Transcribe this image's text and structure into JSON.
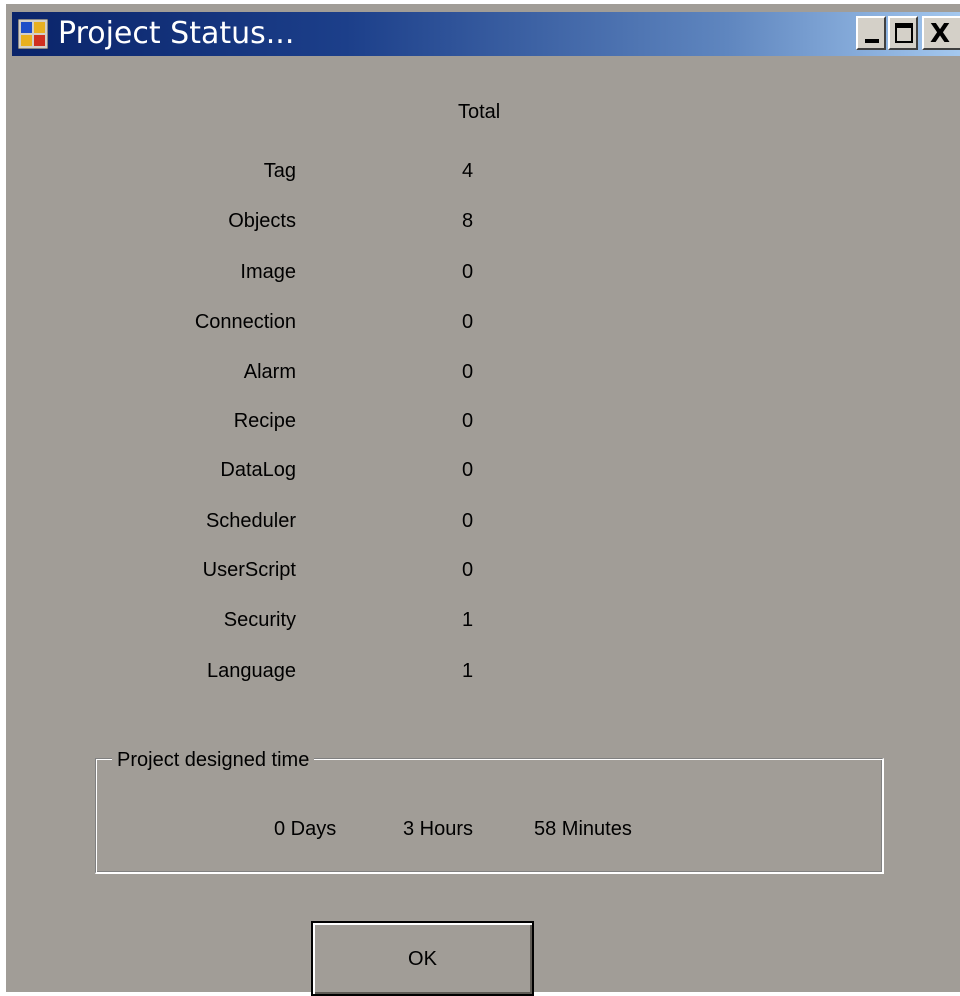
{
  "window": {
    "title": "Project Status...",
    "title_bar_color": "#0a246a",
    "background_color": "#a19d97",
    "icon": "app-window-icon",
    "controls": {
      "minimize_icon": "minimize-icon",
      "maximize_icon": "maximize-icon",
      "close_icon": "close-icon",
      "close_glyph": "X"
    }
  },
  "stats": {
    "column_header": "Total",
    "rows": [
      {
        "label": "Tag",
        "value": "4"
      },
      {
        "label": "Objects",
        "value": "8"
      },
      {
        "label": "Image",
        "value": "0"
      },
      {
        "label": "Connection",
        "value": "0"
      },
      {
        "label": "Alarm",
        "value": "0"
      },
      {
        "label": "Recipe",
        "value": "0"
      },
      {
        "label": "DataLog",
        "value": "0"
      },
      {
        "label": "Scheduler",
        "value": "0"
      },
      {
        "label": "UserScript",
        "value": "0"
      },
      {
        "label": "Security",
        "value": "1"
      },
      {
        "label": "Language",
        "value": "1"
      }
    ]
  },
  "designed_time": {
    "legend": "Project designed time",
    "days": "0 Days",
    "hours": "3 Hours",
    "minutes": "58 Minutes"
  },
  "buttons": {
    "ok_label": "OK"
  }
}
